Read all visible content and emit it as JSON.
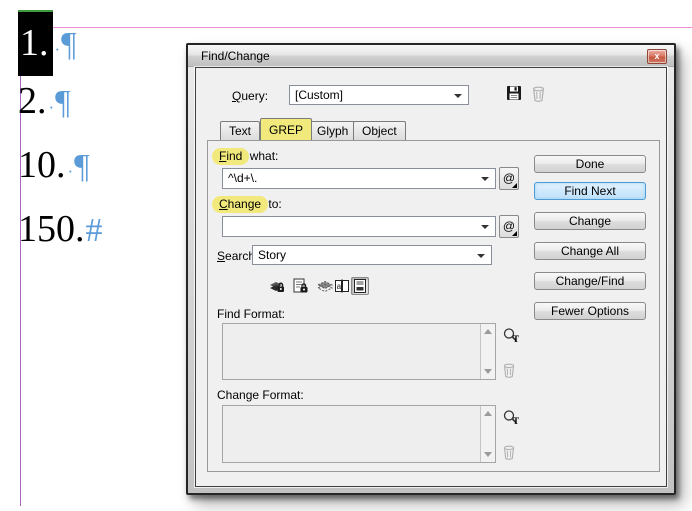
{
  "document": {
    "lines": [
      {
        "number": "1.",
        "space": "·",
        "marker": "¶",
        "selected": true
      },
      {
        "number": "2.",
        "space": "·",
        "marker": "¶",
        "selected": false
      },
      {
        "number": "10.",
        "space": "·",
        "marker": "¶",
        "selected": false
      },
      {
        "number": "150.",
        "space": "",
        "marker": "#",
        "selected": false
      }
    ],
    "colors": {
      "hidden_char_blue": "#5b9bd8",
      "guide_pink": "#ef8cd6",
      "guide_purple": "#a464c0",
      "selection_green_edge": "#3f9b3f"
    }
  },
  "dialog": {
    "title": "Find/Change",
    "close_glyph": "x",
    "query": {
      "mnemonic": "Q",
      "label_rest": "uery:",
      "value": "[Custom]"
    },
    "tabs": [
      {
        "label": "Text",
        "active": false
      },
      {
        "label": "GREP",
        "active": true
      },
      {
        "label": "Glyph",
        "active": false
      },
      {
        "label": "Object",
        "active": false
      }
    ],
    "find_what": {
      "mnemonic": "F",
      "highlight_rest": "ind",
      "label_rest": " what:",
      "value": "^\\d+\\."
    },
    "change_to": {
      "mnemonic": "C",
      "highlight_rest": "hange",
      "label_rest": " to:",
      "value": ""
    },
    "search": {
      "mnemonic": "S",
      "label_rest": "earch:",
      "value": "Story"
    },
    "special_char_glyph": "@",
    "scope_icons": [
      {
        "name": "include-locked-layers",
        "active": false
      },
      {
        "name": "include-locked-stories",
        "active": false
      },
      {
        "name": "include-hidden-layers",
        "active": false
      },
      {
        "name": "include-master-pages",
        "active": false
      },
      {
        "name": "include-footnotes",
        "active": true
      }
    ],
    "find_format_label": "Find Format:",
    "change_format_label": "Change Format:",
    "buttons": [
      {
        "label": "Done",
        "highlighted": false
      },
      {
        "label": "Find Next",
        "highlighted": true
      },
      {
        "label": "Change",
        "highlighted": false
      },
      {
        "label": "Change All",
        "highlighted": false
      },
      {
        "label": "Change/Find",
        "highlighted": false
      },
      {
        "label": "Fewer Options",
        "highlighted": false
      }
    ],
    "colors": {
      "annotation_highlight": "#f1e97c",
      "default_button_bg": "#cfe9fc",
      "default_button_border": "#4f9bd5"
    }
  }
}
